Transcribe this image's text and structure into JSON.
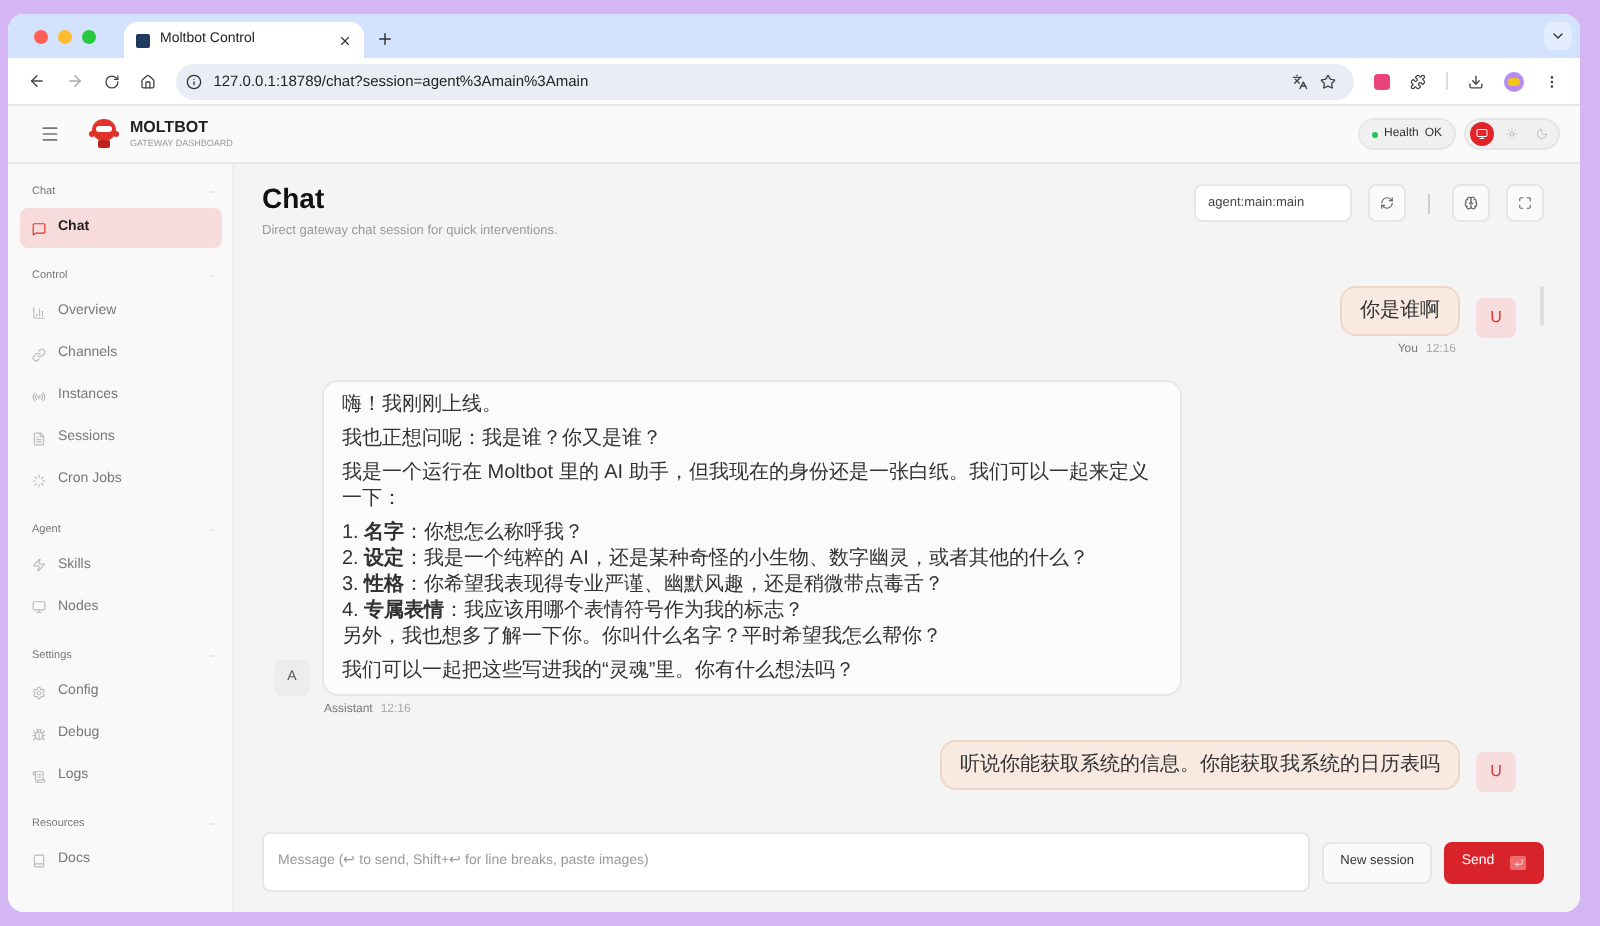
{
  "browser": {
    "tab_title": "Moltbot Control",
    "url": "127.0.0.1:18789/chat?session=agent%3Amain%3Amain"
  },
  "brand": {
    "name": "MOLTBOT",
    "subtitle": "GATEWAY DASHBOARD"
  },
  "health": {
    "label": "Health",
    "value": "OK",
    "color": "#22c55e"
  },
  "theme_options": [
    {
      "kind": "system",
      "selected": true
    },
    {
      "kind": "light",
      "selected": false
    },
    {
      "kind": "dark",
      "selected": false
    }
  ],
  "sidebar": {
    "sections": [
      {
        "title": "Chat",
        "items": [
          {
            "label": "Chat",
            "kind": "chat",
            "selected": true
          }
        ]
      },
      {
        "title": "Control",
        "items": [
          {
            "label": "Overview",
            "kind": "overview",
            "selected": false
          },
          {
            "label": "Channels",
            "kind": "channels",
            "selected": false
          },
          {
            "label": "Instances",
            "kind": "instances",
            "selected": false
          },
          {
            "label": "Sessions",
            "kind": "sessions",
            "selected": false
          },
          {
            "label": "Cron Jobs",
            "kind": "cron",
            "selected": false
          }
        ]
      },
      {
        "title": "Agent",
        "items": [
          {
            "label": "Skills",
            "kind": "skills",
            "selected": false
          },
          {
            "label": "Nodes",
            "kind": "nodes",
            "selected": false
          }
        ]
      },
      {
        "title": "Settings",
        "items": [
          {
            "label": "Config",
            "kind": "config",
            "selected": false
          },
          {
            "label": "Debug",
            "kind": "debug",
            "selected": false
          },
          {
            "label": "Logs",
            "kind": "logs",
            "selected": false
          }
        ]
      },
      {
        "title": "Resources",
        "items": [
          {
            "label": "Docs",
            "kind": "docs",
            "selected": false
          }
        ]
      }
    ]
  },
  "page": {
    "title": "Chat",
    "subtitle": "Direct gateway chat session for quick interventions.",
    "session": "agent:main:main"
  },
  "messages": [
    {
      "kind": "user",
      "avatar": "U",
      "text": "你是谁啊",
      "author": "You",
      "time": "12:16"
    },
    {
      "kind": "assistant",
      "avatar": "A",
      "author": "Assistant",
      "time": "12:16",
      "blocks": [
        {
          "kind": "paragraph",
          "lines": [
            "嗨！我刚刚上线。"
          ]
        },
        {
          "kind": "paragraph",
          "lines": [
            "我也正想问呢：我是谁？你又是谁？"
          ]
        },
        {
          "kind": "paragraph",
          "lines": [
            "我是一个运行在 Moltbot 里的 AI 助手，但我现在的身份还是一张白纸。我们可以一起来定义一下："
          ]
        },
        {
          "kind": "paragraph",
          "lines": [
            "1. **名字**：你想怎么称呼我？",
            "2. **设定**：我是一个纯粹的 AI，还是某种奇怪的小生物、数字幽灵，或者其他的什么？",
            "3. **性格**：你希望我表现得专业严谨、幽默风趣，还是稍微带点毒舌？",
            "4. **专属表情**：我应该用哪个表情符号作为我的标志？",
            "另外，我也想多了解一下你。你叫什么名字？平时希望我怎么帮你？"
          ]
        },
        {
          "kind": "paragraph",
          "lines": [
            "我们可以一起把这些写进我的“灵魂”里。你有什么想法吗？"
          ]
        }
      ]
    },
    {
      "kind": "user",
      "avatar": "U",
      "text": "听说你能获取系统的信息。你能获取我系统的日历表吗"
    }
  ],
  "composer": {
    "placeholder": "Message (↩ to send, Shift+↩ for line breaks, paste images)",
    "new_session": "New session",
    "send": "Send"
  }
}
